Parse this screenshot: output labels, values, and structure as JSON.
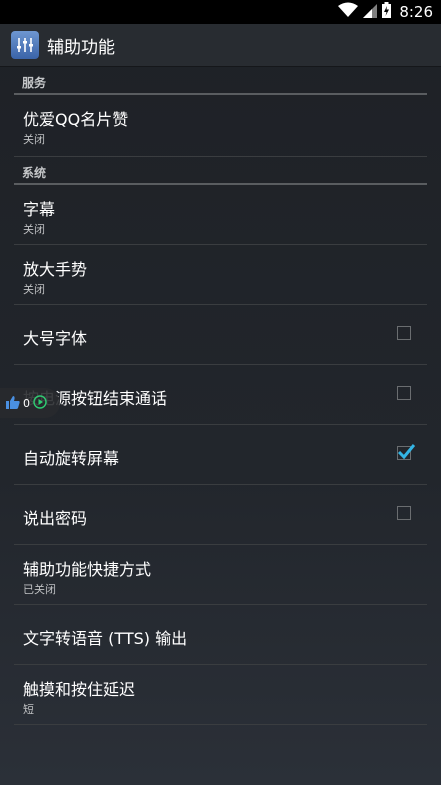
{
  "status_bar": {
    "time": "8:26",
    "icons": [
      "wifi-icon",
      "signal-icon",
      "battery-icon"
    ]
  },
  "action_bar": {
    "title": "辅助功能",
    "icon": "accessibility-app-icon"
  },
  "sections": [
    {
      "header": "服务",
      "items": [
        {
          "title": "优爱QQ名片赞",
          "summary": "关闭"
        }
      ]
    },
    {
      "header": "系统",
      "items": [
        {
          "title": "字幕",
          "summary": "关闭"
        },
        {
          "title": "放大手势",
          "summary": "关闭"
        },
        {
          "title": "大号字体",
          "checked": false
        },
        {
          "title": "按电源按钮结束通话",
          "checked": false
        },
        {
          "title": "自动旋转屏幕",
          "checked": true
        },
        {
          "title": "说出密码",
          "checked": false
        },
        {
          "title": "辅助功能快捷方式",
          "summary": "已关闭"
        },
        {
          "title": "文字转语音 (TTS) 输出"
        },
        {
          "title": "触摸和按住延迟",
          "summary": "短"
        }
      ]
    }
  ],
  "floating_widget": {
    "count": "0",
    "icon": "thumbs-up-icon"
  },
  "colors": {
    "accent": "#33b5e5",
    "background": "#22262c",
    "divider": "#3a3d40"
  }
}
